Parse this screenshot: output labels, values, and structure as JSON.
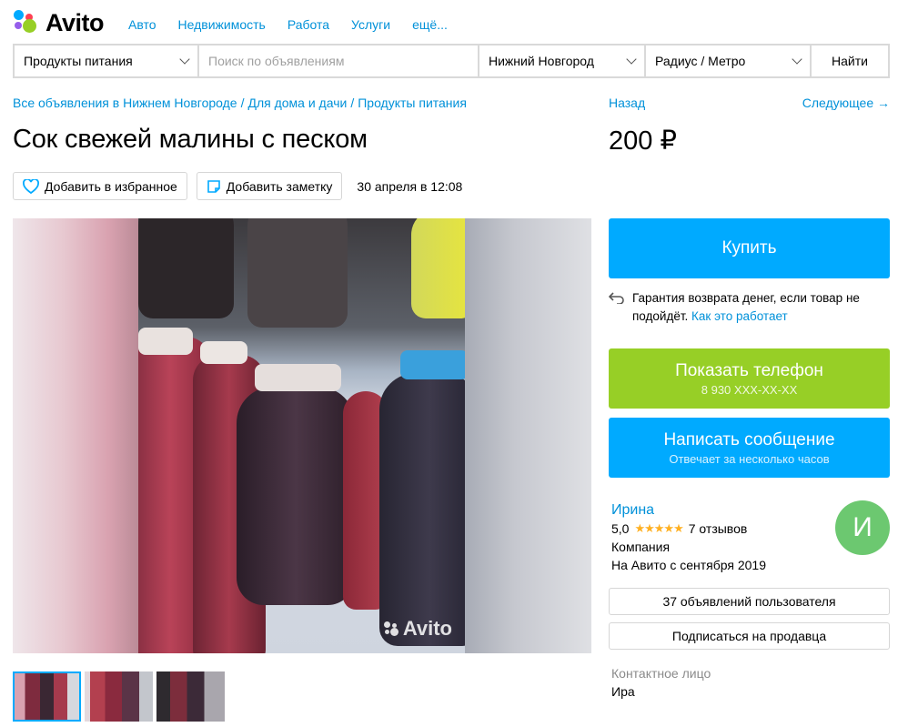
{
  "header": {
    "logo_text": "Avito",
    "nav": [
      "Авто",
      "Недвижимость",
      "Работа",
      "Услуги",
      "ещё..."
    ]
  },
  "search": {
    "category": "Продукты питания",
    "placeholder": "Поиск по объявлениям",
    "city": "Нижний Новгород",
    "radius": "Радиус / Метро",
    "submit": "Найти"
  },
  "breadcrumbs": [
    "Все объявления в Нижнем Новгороде",
    "Для дома и дачи",
    "Продукты питания"
  ],
  "nav_back": "Назад",
  "nav_next": "Следующее →",
  "listing": {
    "title": "Сок свежей малины с песком",
    "price": "200 ₽",
    "favorite": "Добавить в избранное",
    "note": "Добавить заметку",
    "date": "30 апреля в 12:08",
    "watermark": "Avito"
  },
  "actions": {
    "buy": "Купить",
    "guarantee_text": "Гарантия возврата денег, если товар не подойдёт.",
    "guarantee_link": "Как это работает",
    "phone_label": "Показать телефон",
    "phone_masked": "8 930 XXX-XX-XX",
    "message_label": "Написать сообщение",
    "message_sub": "Отвечает за несколько часов"
  },
  "seller": {
    "name": "Ирина",
    "rating": "5,0",
    "stars": 5,
    "reviews": "7 отзывов",
    "type": "Компания",
    "since": "На Авито с сентября 2019",
    "avatar_letter": "И",
    "listings_button": "37 объявлений пользователя",
    "subscribe_button": "Подписаться на продавца",
    "contact_label": "Контактное лицо",
    "contact_name": "Ира"
  },
  "thumbnails": 3,
  "colors": {
    "accent_blue": "#00aaff",
    "green": "#97cf26",
    "link": "#0091d9",
    "star": "#ffb021",
    "avatar_bg": "#6cc870"
  }
}
